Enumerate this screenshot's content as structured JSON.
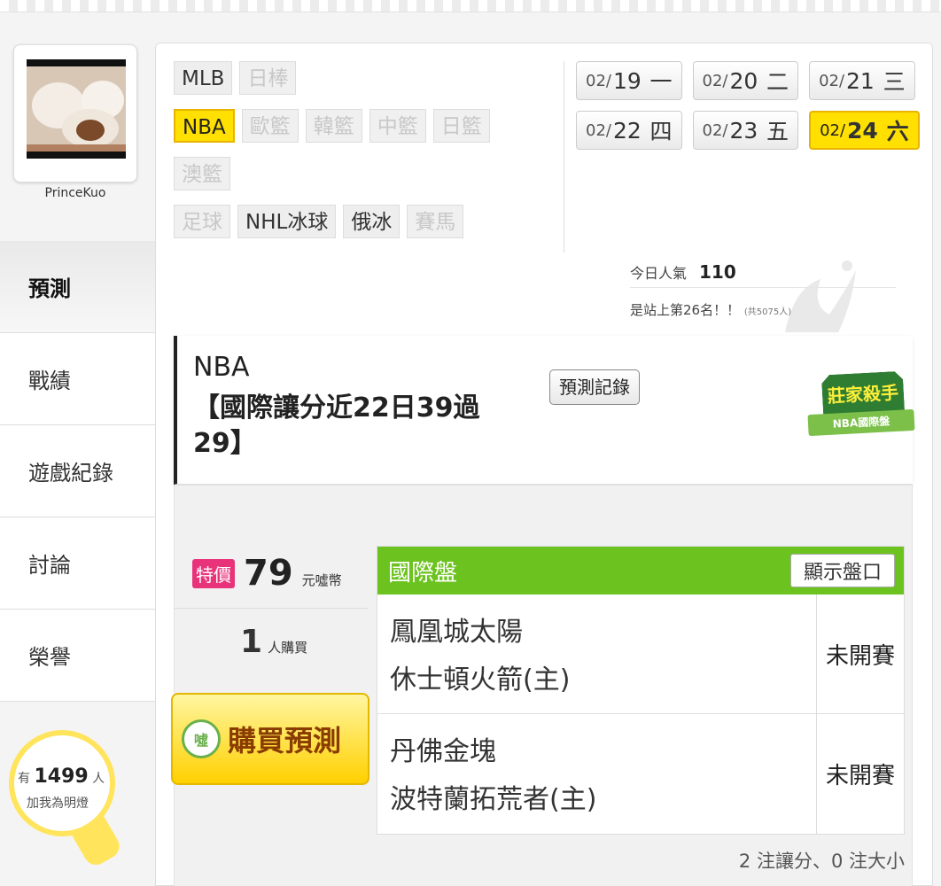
{
  "user": {
    "name": "PrinceKuo"
  },
  "nav": [
    {
      "label": "預測",
      "active": true
    },
    {
      "label": "戰績"
    },
    {
      "label": "遊戲紀錄"
    },
    {
      "label": "討論"
    },
    {
      "label": "榮譽"
    }
  ],
  "fans": {
    "prefix": "有",
    "count": "1499",
    "suffix": "人",
    "label": "加我為明燈"
  },
  "sports": {
    "row1": [
      {
        "label": "MLB"
      },
      {
        "label": "日棒",
        "disabled": true
      }
    ],
    "row2": [
      {
        "label": "NBA",
        "active": true
      },
      {
        "label": "歐籃",
        "disabled": true
      },
      {
        "label": "韓籃",
        "disabled": true
      },
      {
        "label": "中籃",
        "disabled": true
      },
      {
        "label": "日籃",
        "disabled": true
      }
    ],
    "row3": [
      {
        "label": "澳籃",
        "disabled": true
      }
    ],
    "row4": [
      {
        "label": "足球",
        "disabled": true
      },
      {
        "label": "NHL冰球"
      },
      {
        "label": "俄冰"
      },
      {
        "label": "賽馬",
        "disabled": true
      }
    ]
  },
  "dates": {
    "row1": [
      {
        "md": "02/",
        "day": "19",
        "wd": "一"
      },
      {
        "md": "02/",
        "day": "20",
        "wd": "二"
      },
      {
        "md": "02/",
        "day": "21",
        "wd": "三"
      }
    ],
    "row2": [
      {
        "md": "02/",
        "day": "22",
        "wd": "四"
      },
      {
        "md": "02/",
        "day": "23",
        "wd": "五"
      },
      {
        "md": "02/",
        "day": "24",
        "wd": "六",
        "active": true
      }
    ]
  },
  "popularity": {
    "label": "今日人氣",
    "value": "110",
    "rank_text": "是站上第26名！！",
    "total": "(共5075人)"
  },
  "prediction": {
    "league": "NBA",
    "title": "【國際讓分近22日39過29】",
    "record_button": "預測記錄",
    "badge_title": "莊家殺手",
    "badge_sub": "NBA國際盤"
  },
  "purchase": {
    "sale_tag": "特價",
    "price": "79",
    "unit": "元噓幣",
    "buyers": "1",
    "buyers_label": "人購買",
    "buy_icon": "噓",
    "buy_label": "購買預測"
  },
  "table": {
    "title": "國際盤",
    "show_button": "顯示盤口",
    "games": [
      {
        "away": "鳳凰城太陽",
        "home": "休士頓火箭(主)",
        "status": "未開賽"
      },
      {
        "away": "丹佛金塊",
        "home": "波特蘭拓荒者(主)",
        "status": "未開賽"
      }
    ]
  },
  "summary": "2 注讓分、0 注大小",
  "colors": {
    "accent_yellow": "#ffe000",
    "table_green": "#6cc31f",
    "sale_pink": "#e8337a"
  }
}
